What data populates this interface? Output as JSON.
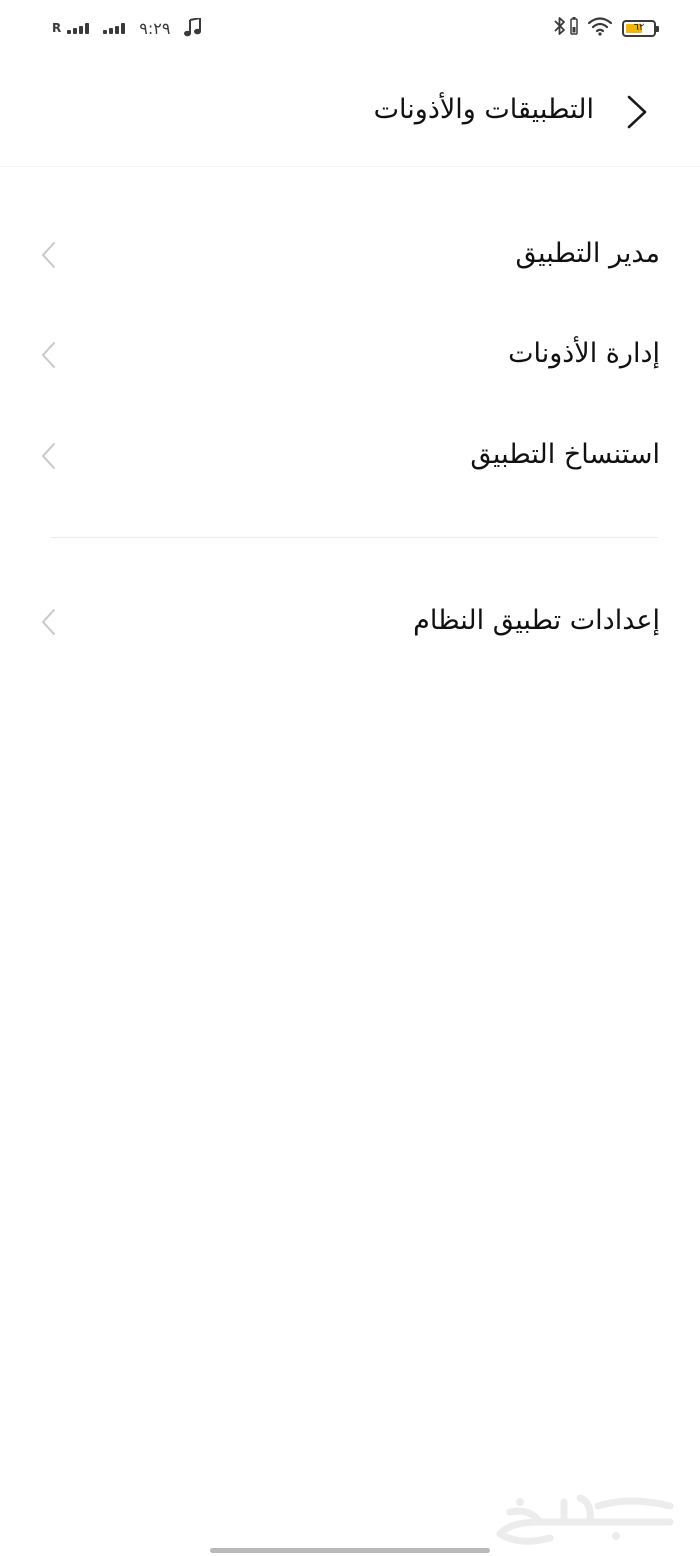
{
  "status_bar": {
    "roaming": "R",
    "time": "٩:٢٩",
    "battery": "٦٢",
    "battery_level": 0.62,
    "icons": [
      "signal-icon",
      "signal-icon",
      "music-note-icon",
      "bluetooth-icon",
      "battery-saver-icon",
      "wifi-icon",
      "battery-icon"
    ]
  },
  "header": {
    "title": "التطبيقات والأذونات",
    "back_icon": "chevron-right-icon"
  },
  "menu": {
    "items": [
      {
        "label": "مدير التطبيق",
        "icon": "chevron-left-icon"
      },
      {
        "label": "إدارة الأذونات",
        "icon": "chevron-left-icon"
      },
      {
        "label": "استنساخ التطبيق",
        "icon": "chevron-left-icon"
      },
      {
        "label": "إعدادات تطبيق النظام",
        "icon": "chevron-left-icon"
      }
    ]
  },
  "colors": {
    "battery_accent": "#f2b705",
    "text_primary": "#111111",
    "chevron": "#c8c8c8"
  }
}
